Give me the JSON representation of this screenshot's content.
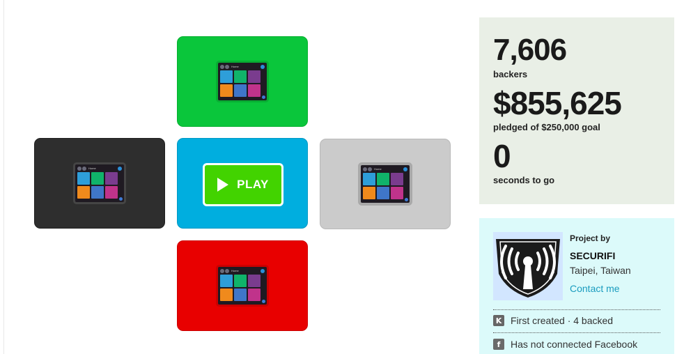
{
  "player": {
    "play_label": "PLAY",
    "tiles": [
      {
        "name": "green",
        "color": "#0ac63b"
      },
      {
        "name": "black",
        "color": "#2e2e2e"
      },
      {
        "name": "blue",
        "color": "#00aedf"
      },
      {
        "name": "gray",
        "color": "#cbcbcb"
      },
      {
        "name": "red",
        "color": "#e80000"
      }
    ],
    "device_screen_title": "Home"
  },
  "stats": {
    "backers_count": "7,606",
    "backers_label": "backers",
    "pledged_amount": "$855,625",
    "pledged_label": "pledged of $250,000 goal",
    "time_left": "0",
    "time_label": "seconds to go"
  },
  "creator": {
    "project_by_label": "Project by",
    "name": "SECURIFI",
    "location": "Taipei, Taiwan",
    "contact_link": "Contact me",
    "history_icon": "kickstarter-k-icon",
    "history_text": "First created · 4 backed",
    "facebook_icon": "facebook-icon",
    "facebook_text": "Has not connected Facebook"
  },
  "colors": {
    "stats_bg": "#e9efe6",
    "creator_bg": "#dcfafa",
    "link": "#1a9cbf",
    "play_green": "#42d300"
  }
}
